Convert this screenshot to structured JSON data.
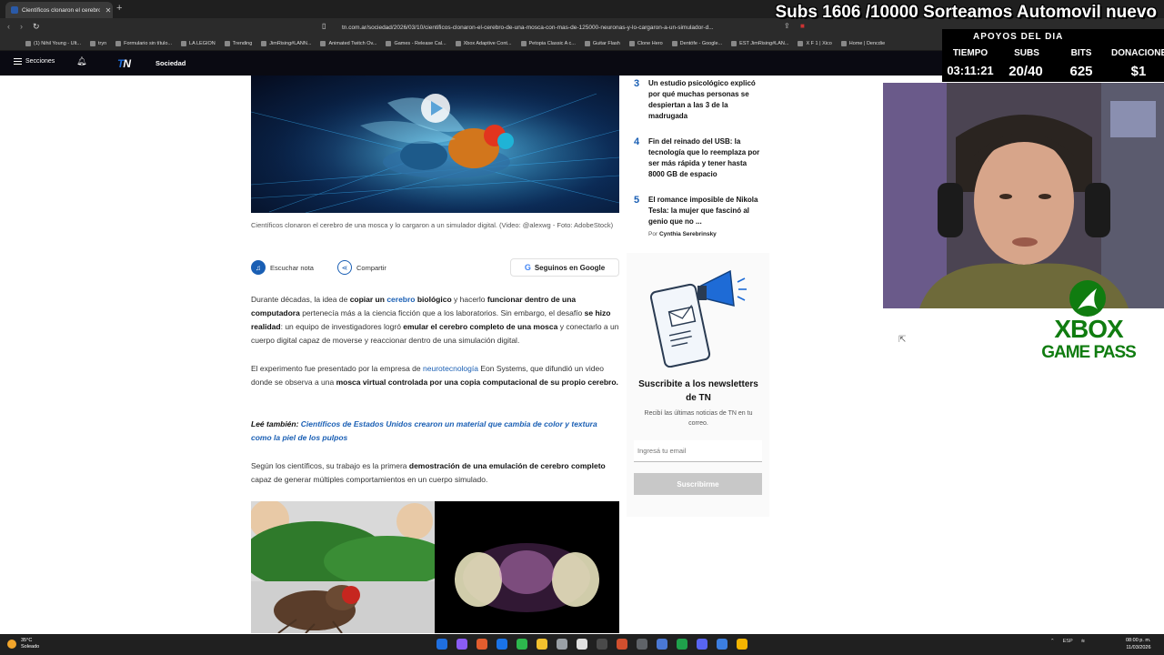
{
  "browser": {
    "tab_title": "Científicos clonaron el cerebro d",
    "url": "tn.com.ar/sociedad/2026/03/10/cientificos-clonaron-el-cerebro-de-una-mosca-con-mas-de-125000-neuronas-y-lo-cargaron-a-un-simulador-d...",
    "bookmarks": [
      "(1) Nihil Young - Ult...",
      "tryn",
      "Formulario sin título...",
      "LA LEGION",
      "Trending",
      "JimRising#LANN...",
      "Animated Twitch Ov...",
      "Games - Release Cal...",
      "Xbox Adaptive Cont...",
      "Petopia Classic A c...",
      "Guitar Flash",
      "Clone Hero",
      "Dentófe - Google...",
      "EST JimRising#LAN...",
      "X F 1 | Xico",
      "Home | Dencdie"
    ]
  },
  "site": {
    "menu_label": "Secciones",
    "logo_t": "T",
    "logo_n": "N",
    "section": "Sociedad"
  },
  "article": {
    "caption": "Científicos clonaron el cerebro de una mosca y lo cargaron a un simulador digital. (Video: @alexwg - Foto: AdobeStock)",
    "listen_label": "Escuchar nota",
    "share_label": "Compartir",
    "google_label": "Seguinos en Google",
    "p1": {
      "a": "Durante décadas, la idea de ",
      "b": "copiar un ",
      "c": "cerebro",
      "d": " biológico",
      "e": " y hacerlo ",
      "f": "funcionar dentro de una computadora",
      "g": " pertenecía más a la ciencia ficción que a los laboratorios. Sin embargo, el desafío ",
      "h": "se hizo realidad",
      "i": ": un equipo de investigadores logró ",
      "j": "emular el cerebro completo de una mosca",
      "k": " y conectarlo a un cuerpo digital capaz de moverse y reaccionar dentro de una simulación digital."
    },
    "p2": {
      "a": "El experimento fue presentado por la empresa de ",
      "b": "neurotecnología",
      "c": " Eon Systems, que difundió un video donde se observa a una ",
      "d": "mosca virtual controlada por una copia computacional de su propio cerebro."
    },
    "p3": {
      "a": "Leé también: ",
      "b": "Científicos de Estados Unidos crearon un material que cambia de color y textura como la piel de los pulpos"
    },
    "p4": {
      "a": "Según los científicos, su trabajo es la primera ",
      "b": "demostración de una emulación de cerebro completo",
      "c": " capaz de generar múltiples comportamientos en un cuerpo simulado."
    }
  },
  "sidebar": {
    "ranked": [
      {
        "num": "3",
        "title": "Un estudio psicológico explicó por qué muchas personas se despiertan a las 3 de la madrugada"
      },
      {
        "num": "4",
        "title": "Fin del reinado del USB: la tecnología que lo reemplaza por ser más rápida y tener hasta 8000 GB de espacio"
      },
      {
        "num": "5",
        "title": "El romance imposible de Nikola Tesla: la mujer que fascinó al genio que no ..."
      }
    ],
    "author_prefix": "Por",
    "author": "Cynthia Serebrinsky",
    "newsletter": {
      "title": "Suscribite a los newsletters de TN",
      "subtitle": "Recibí las últimas noticias de TN en tu correo.",
      "placeholder": "Ingresá tu email",
      "button": "Suscribirme"
    }
  },
  "stream": {
    "banner": "Subs 1606 /10000 Sorteamos Automovil nuevo",
    "apoyos_title": "APOYOS DEL DIA",
    "headers": [
      "TIEMPO",
      "SUBS",
      "BITS",
      "DONACIONES"
    ],
    "values": [
      "03:11:21",
      "20/40",
      "625",
      "$1"
    ],
    "xbox_line1": "XBOX",
    "xbox_line2": "GAME PASS"
  },
  "taskbar": {
    "temp": "35°C",
    "weather": "Soleado",
    "lang": "ESP",
    "time": "08:00 p. m.",
    "date": "11/03/2026"
  },
  "colors": {
    "link": "#1a5fb4",
    "xbox_green": "#107c10",
    "tn_header": "#0a0a12"
  }
}
